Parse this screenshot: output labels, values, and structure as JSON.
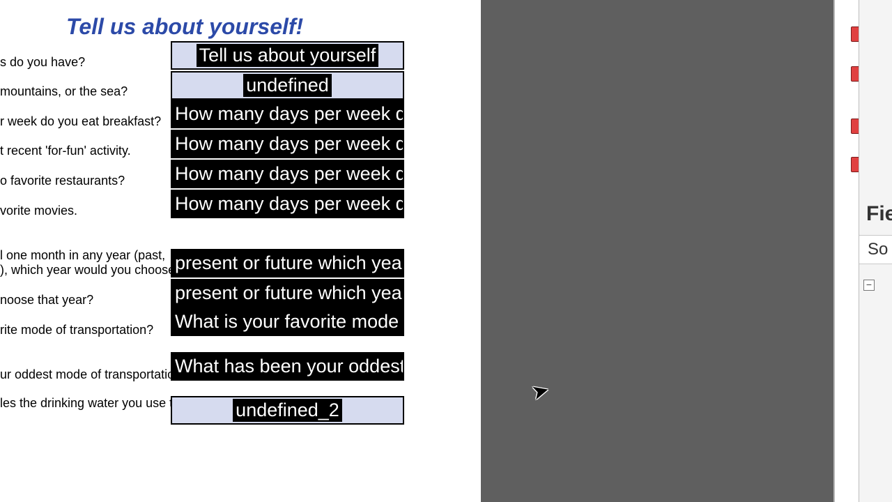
{
  "form": {
    "title": "Tell us about yourself!",
    "questions": {
      "q1": "s do you have?",
      "q2": "mountains, or the sea?",
      "q3": "r week do you eat breakfast?",
      "q4": "t recent 'for-fun' activity.",
      "q5": "o favorite restaurants?",
      "q6": "vorite movies.",
      "q7a": "l one month in any year (past,",
      "q7b": "), which year would you choose?",
      "q8": "noose that year?",
      "q9": "rite mode of transportation?",
      "q10": "ur oddest mode of transportation?",
      "q11": "les the drinking water you use the"
    },
    "fields": {
      "f_title": "Tell us about yourself",
      "f_undefined": "undefined",
      "f_days1": "How many days per week do you",
      "f_days2": "How many days per week do you",
      "f_days3": "How many days per week do you",
      "f_days4": "How many days per week do you",
      "f_year1": "present or future which year wou",
      "f_year2": "present or future which year wou",
      "f_mode": "What is your favorite mode of tra",
      "f_oddest": "What has been your oddest mode",
      "f_undefined2": "undefined_2"
    }
  },
  "panel": {
    "title": "Fie",
    "sort": "So"
  }
}
